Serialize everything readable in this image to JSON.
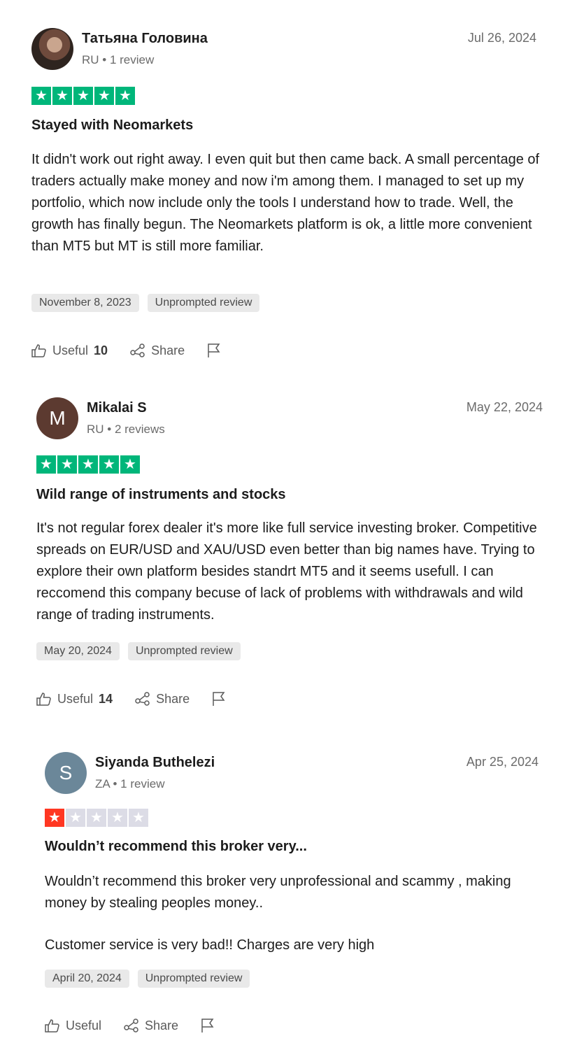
{
  "reviews": [
    {
      "name": "Татьяна Головина",
      "meta": "RU • 1 review",
      "date": "Jul 26, 2024",
      "avatar_letter": "",
      "avatar_color": "#4a3a33",
      "rating": 5,
      "star_color": "#00b67a",
      "title": "Stayed with Neomarkets",
      "body": [
        "It didn't work out right away. I even quit but then came back. A small percentage of traders actually make money and now i'm among them. I managed to set up my portfolio, which now include only the tools I understand how to trade. Well, the growth has finally begun. The Neomarkets platform is ok, a little more convenient than MT5 but MT is still more familiar."
      ],
      "experience_date": "November 8, 2023",
      "tag": "Unprompted review",
      "useful_label": "Useful",
      "useful_count": "10",
      "share_label": "Share"
    },
    {
      "name": "Mikalai S",
      "meta": "RU • 2 reviews",
      "date": "May 22, 2024",
      "avatar_letter": "M",
      "avatar_color": "#5c3a30",
      "rating": 5,
      "star_color": "#00b67a",
      "title": "Wild range of instruments and stocks",
      "body": [
        "It's not regular forex dealer it's more like full service investing broker. Competitive spreads on EUR/USD and XAU/USD even better than big names have. Trying to explore their own platform besides standrt MT5 and it seems usefull. I can reccomend this company becuse of lack of problems with withdrawals and wild range of trading instruments."
      ],
      "experience_date": "May 20, 2024",
      "tag": "Unprompted review",
      "useful_label": "Useful",
      "useful_count": "14",
      "share_label": "Share"
    },
    {
      "name": "Siyanda Buthelezi",
      "meta": "ZA • 1 review",
      "date": "Apr 25, 2024",
      "avatar_letter": "S",
      "avatar_color": "#6b8799",
      "rating": 1,
      "star_color": "#ff3722",
      "title": "Wouldn’t recommend this broker very...",
      "body": [
        "Wouldn’t recommend this broker very unprofessional and scammy , making money by stealing peoples money..",
        "Customer service is very bad!! Charges are very high"
      ],
      "experience_date": "April 20, 2024",
      "tag": "Unprompted review",
      "useful_label": "Useful",
      "useful_count": "",
      "share_label": "Share"
    }
  ],
  "icons": {
    "useful": "thumbs-up-icon",
    "share": "share-icon",
    "report": "flag-icon"
  }
}
